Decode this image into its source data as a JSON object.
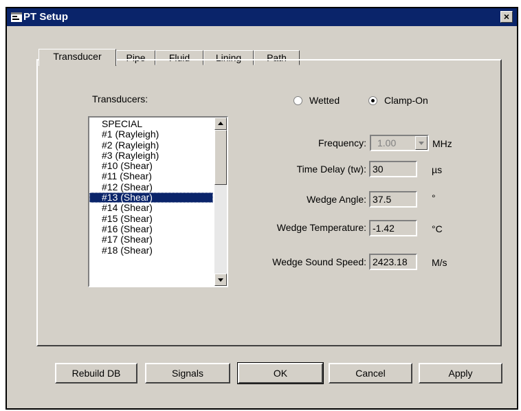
{
  "window": {
    "title": "PT Setup",
    "close_label": "×"
  },
  "tabs": [
    {
      "label": "Transducer",
      "active": true
    },
    {
      "label": "Pipe",
      "active": false
    },
    {
      "label": "Fluid",
      "active": false
    },
    {
      "label": "Lining",
      "active": false
    },
    {
      "label": "Path",
      "active": false
    }
  ],
  "transducer": {
    "list_label": "Transducers:",
    "items": [
      "SPECIAL",
      "#1 (Rayleigh)",
      "#2 (Rayleigh)",
      "#3 (Rayleigh)",
      "#10 (Shear)",
      "#11 (Shear)",
      "#12 (Shear)",
      "#13 (Shear)",
      "#14 (Shear)",
      "#15 (Shear)",
      "#16 (Shear)",
      "#17 (Shear)",
      "#18 (Shear)"
    ],
    "selected_item": "#13 (Shear)",
    "mount_options": [
      {
        "label": "Wetted",
        "checked": false
      },
      {
        "label": "Clamp-On",
        "checked": true
      }
    ],
    "fields": {
      "frequency": {
        "label": "Frequency:",
        "value": "1.00",
        "unit": "MHz"
      },
      "time_delay": {
        "label": "Time Delay (tw):",
        "value": "30",
        "unit": "µs"
      },
      "wedge_angle": {
        "label": "Wedge Angle:",
        "value": "37.5",
        "unit": "°"
      },
      "wedge_temperature": {
        "label": "Wedge Temperature:",
        "value": "-1.42",
        "unit": "°C"
      },
      "wedge_sound_speed": {
        "label": "Wedge Sound Speed:",
        "value": "2423.18",
        "unit": "M/s"
      }
    }
  },
  "buttons": {
    "rebuild": "Rebuild DB",
    "signals": "Signals",
    "ok": "OK",
    "cancel": "Cancel",
    "apply": "Apply"
  },
  "colors": {
    "titlebar": "#0a246a",
    "dialog_face": "#d4d0c8",
    "selection": "#0a246a"
  }
}
